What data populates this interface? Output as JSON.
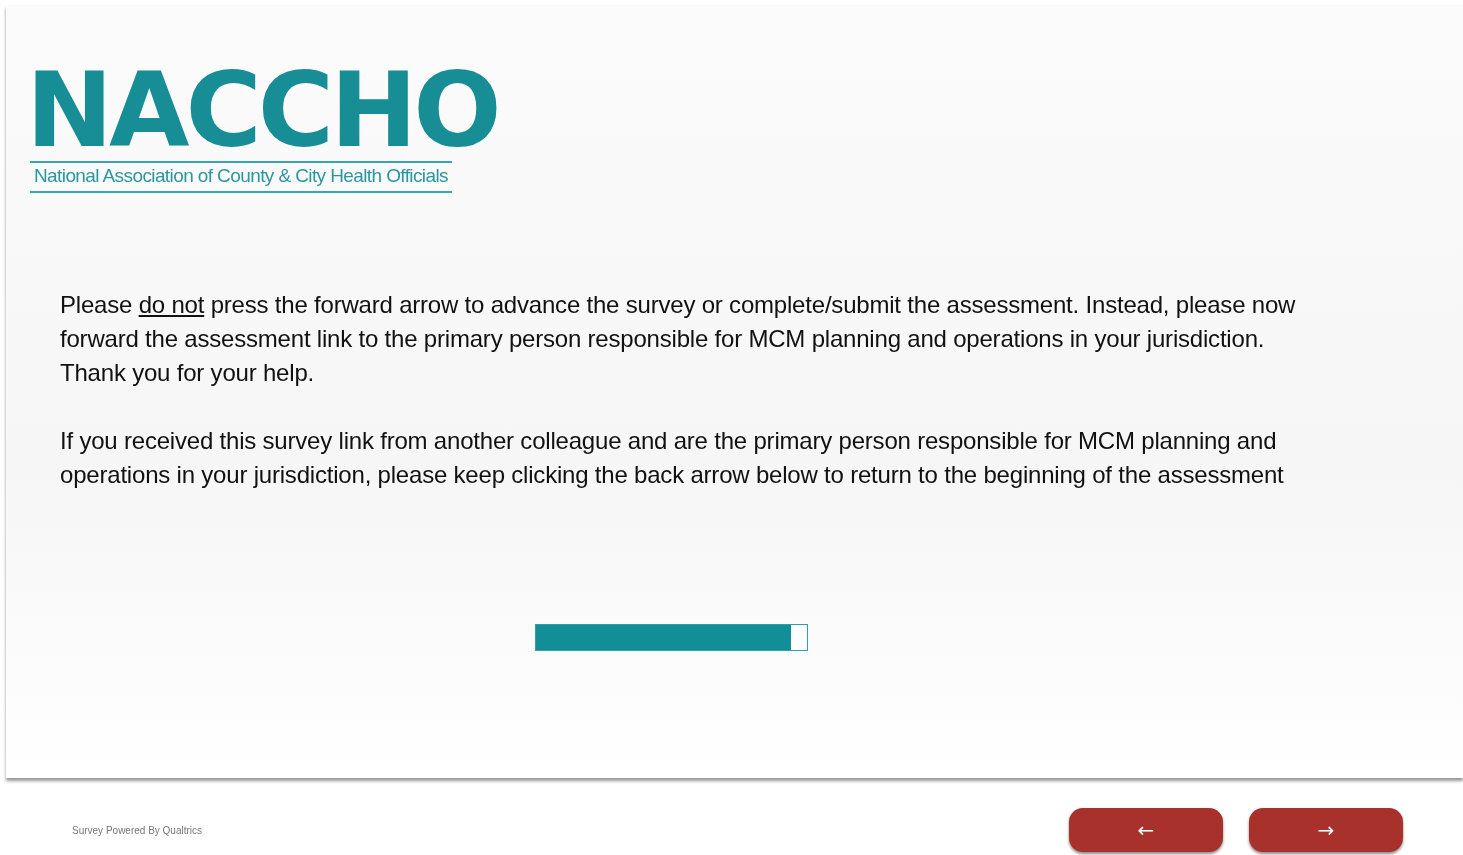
{
  "logo": {
    "name": "NACCHO",
    "tagline": "National Association of County & City Health Officials"
  },
  "paragraphs": [
    [
      {
        "text": "Please ",
        "underline": false
      },
      {
        "text": "do not",
        "underline": true
      },
      {
        "text": " press the forward arrow to advance the survey or complete/submit the assessment. Instead, please now forward the assessment link to the primary person responsible for MCM planning and operations in your jurisdiction. Thank you for your help.",
        "underline": false
      }
    ],
    [
      {
        "text": "If you received this survey link from another colleague and are the primary person responsible for MCM planning and operations in your jurisdiction, please keep clicking the back arrow below to return to the beginning of the assessment",
        "underline": false
      }
    ]
  ],
  "progress": {
    "level": 0.94
  },
  "footer": {
    "powered_by": "Survey Powered By Qualtrics"
  },
  "buttons": [
    {
      "label": "←"
    },
    {
      "label": "→"
    }
  ]
}
